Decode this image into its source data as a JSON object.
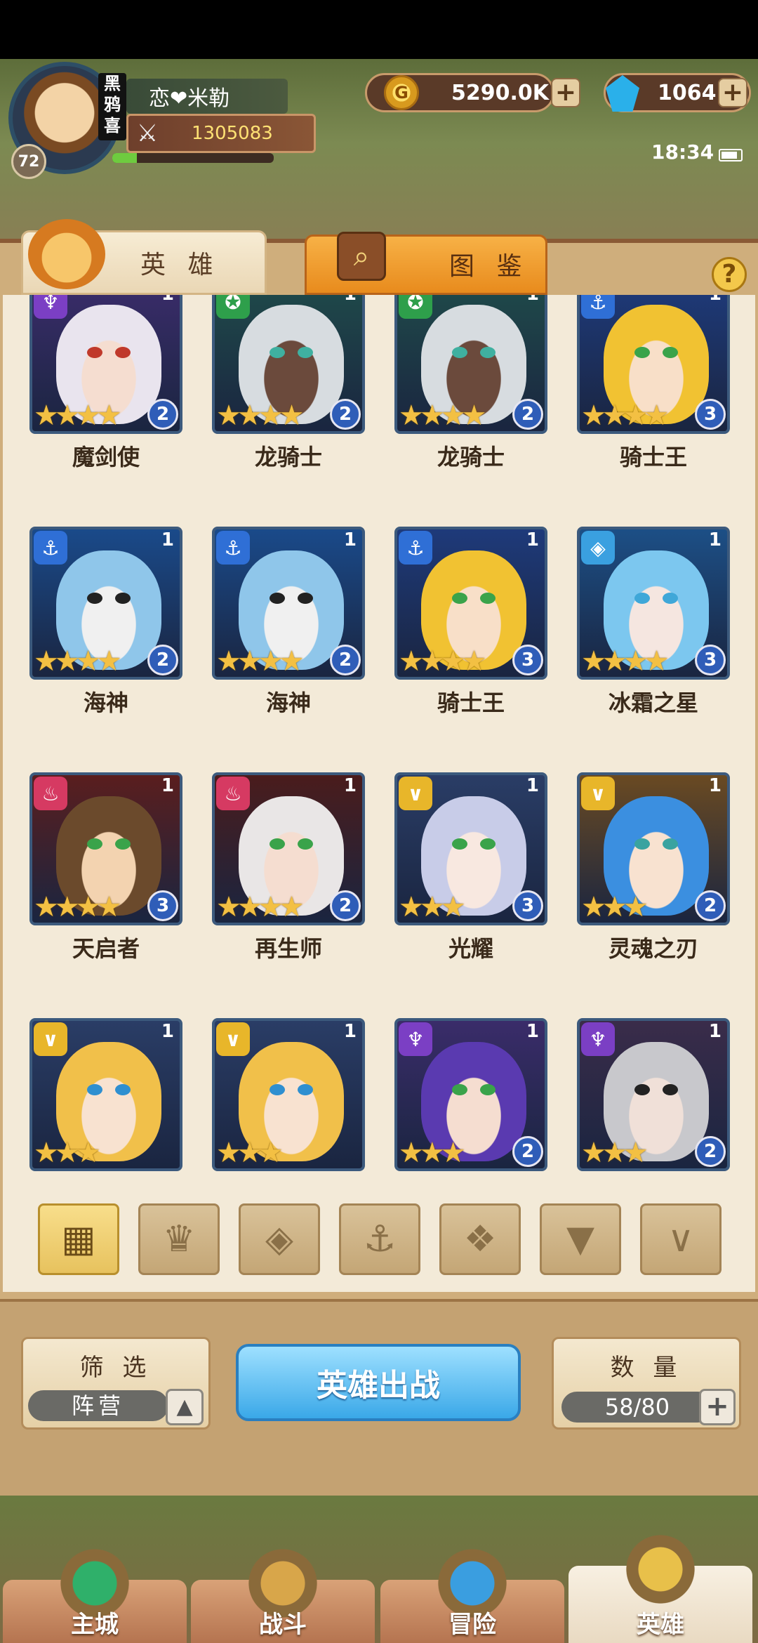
{
  "player": {
    "name": "恋❤米勒",
    "level": "72",
    "vip_label": "黑鸦喜",
    "power": "1305083",
    "exp_progress": 0.15
  },
  "currency": {
    "gold": "5290.0K",
    "gems": "1064"
  },
  "system": {
    "time": "18:34"
  },
  "tabs": [
    {
      "label": "英 雄",
      "active": true
    },
    {
      "label": "图 鉴",
      "active": false
    }
  ],
  "heroes": [
    {
      "name": "魔剑使",
      "count": "1",
      "stars": 4,
      "rank": "2",
      "faction": "dark",
      "faction_color": "#7b3fc4",
      "bg": "#3a2c6a",
      "hair": "#e9e4ee",
      "eye": "#c0392b",
      "skin": "#f5ddd0"
    },
    {
      "name": "龙骑士",
      "count": "1",
      "stars": 4,
      "rank": "2",
      "faction": "beast",
      "faction_color": "#2e9f4b",
      "bg": "#1f4a4a",
      "hair": "#d7dce0",
      "eye": "#3fb0a0",
      "skin": "#6b4a3c"
    },
    {
      "name": "龙骑士",
      "count": "1",
      "stars": 4,
      "rank": "2",
      "faction": "beast",
      "faction_color": "#2e9f4b",
      "bg": "#1f4a4a",
      "hair": "#d7dce0",
      "eye": "#3fb0a0",
      "skin": "#6b4a3c"
    },
    {
      "name": "骑士王",
      "count": "1",
      "stars": 4,
      "rank": "3",
      "faction": "water",
      "faction_color": "#2f6fd6",
      "bg": "#1e3a7a",
      "hair": "#f1c232",
      "eye": "#3aa34a",
      "skin": "#f8dfc8"
    },
    {
      "name": "海神",
      "count": "1",
      "stars": 4,
      "rank": "2",
      "faction": "water",
      "faction_color": "#2f6fd6",
      "bg": "#1a4a8a",
      "hair": "#8fc6ea",
      "eye": "#222222",
      "skin": "#f0f0f0"
    },
    {
      "name": "海神",
      "count": "1",
      "stars": 4,
      "rank": "2",
      "faction": "water",
      "faction_color": "#2f6fd6",
      "bg": "#1a4a8a",
      "hair": "#8fc6ea",
      "eye": "#222222",
      "skin": "#f0f0f0"
    },
    {
      "name": "骑士王",
      "count": "1",
      "stars": 4,
      "rank": "3",
      "faction": "water",
      "faction_color": "#2f6fd6",
      "bg": "#1e3a7a",
      "hair": "#f1c232",
      "eye": "#3aa34a",
      "skin": "#f8dfc8"
    },
    {
      "name": "冰霜之星",
      "count": "1",
      "stars": 4,
      "rank": "3",
      "faction": "ice",
      "faction_color": "#3aa0e0",
      "bg": "#1c4f86",
      "hair": "#7cc7ef",
      "eye": "#3fa7d8",
      "skin": "#f5e6e0"
    },
    {
      "name": "天启者",
      "count": "1",
      "stars": 4,
      "rank": "3",
      "faction": "fire",
      "faction_color": "#d63a62",
      "bg": "#5a1e1e",
      "hair": "#6b4a2c",
      "eye": "#3aa34a",
      "skin": "#f3d3b0"
    },
    {
      "name": "再生师",
      "count": "1",
      "stars": 4,
      "rank": "2",
      "faction": "fire",
      "faction_color": "#d63a62",
      "bg": "#4a1c1c",
      "hair": "#e9e6e6",
      "eye": "#3aa34a",
      "skin": "#f5ddd0"
    },
    {
      "name": "光耀",
      "count": "1",
      "stars": 3,
      "rank": "3",
      "faction": "light",
      "faction_color": "#e8b62a",
      "bg": "#2a3d66",
      "hair": "#c8cce8",
      "eye": "#3aa34a",
      "skin": "#f8e8e0"
    },
    {
      "name": "灵魂之刃",
      "count": "1",
      "stars": 3,
      "rank": "2",
      "faction": "light",
      "faction_color": "#e8b62a",
      "bg": "#6a4a22",
      "hair": "#3b8fe0",
      "eye": "#3aa3a0",
      "skin": "#f8e2d0"
    },
    {
      "name": "",
      "count": "1",
      "stars": 3,
      "rank": "",
      "faction": "light",
      "faction_color": "#e8b62a",
      "bg": "#2a3d66",
      "hair": "#f1c04a",
      "eye": "#2f8fd0",
      "skin": "#f8e2d0"
    },
    {
      "name": "",
      "count": "1",
      "stars": 3,
      "rank": "",
      "faction": "light",
      "faction_color": "#e8b62a",
      "bg": "#2a3d66",
      "hair": "#f1c04a",
      "eye": "#2f8fd0",
      "skin": "#f8e2d0"
    },
    {
      "name": "",
      "count": "1",
      "stars": 3,
      "rank": "2",
      "faction": "dark",
      "faction_color": "#7b3fc4",
      "bg": "#3a2c6a",
      "hair": "#5a3ab0",
      "eye": "#3aa34a",
      "skin": "#f5ddd0"
    },
    {
      "name": "",
      "count": "1",
      "stars": 3,
      "rank": "2",
      "faction": "dark",
      "faction_color": "#7b3fc4",
      "bg": "#3a2c4a",
      "hair": "#c8c8cc",
      "eye": "#222222",
      "skin": "#f0e0d8"
    }
  ],
  "filters": [
    {
      "icon": "grid-icon",
      "glyph": "▦",
      "active": true
    },
    {
      "icon": "fire-faction-icon",
      "glyph": "♛",
      "active": false
    },
    {
      "icon": "ice-faction-icon",
      "glyph": "◈",
      "active": false
    },
    {
      "icon": "anchor-faction-icon",
      "glyph": "⚓",
      "active": false
    },
    {
      "icon": "beast-faction-icon",
      "glyph": "❖",
      "active": false
    },
    {
      "icon": "dark-faction-icon",
      "glyph": "▼",
      "active": false
    },
    {
      "icon": "light-faction-icon",
      "glyph": "∨",
      "active": false
    }
  ],
  "controls": {
    "filter_title": "筛 选",
    "filter_value": "阵营",
    "deploy_label": "英雄出战",
    "count_title": "数 量",
    "count_value": "58/80"
  },
  "nav": [
    {
      "label": "主城",
      "active": false,
      "icon": "city-icon"
    },
    {
      "label": "战斗",
      "active": false,
      "icon": "swords-icon"
    },
    {
      "label": "冒险",
      "active": false,
      "icon": "map-icon"
    },
    {
      "label": "英雄",
      "active": true,
      "icon": "hero-helmet-icon"
    }
  ]
}
